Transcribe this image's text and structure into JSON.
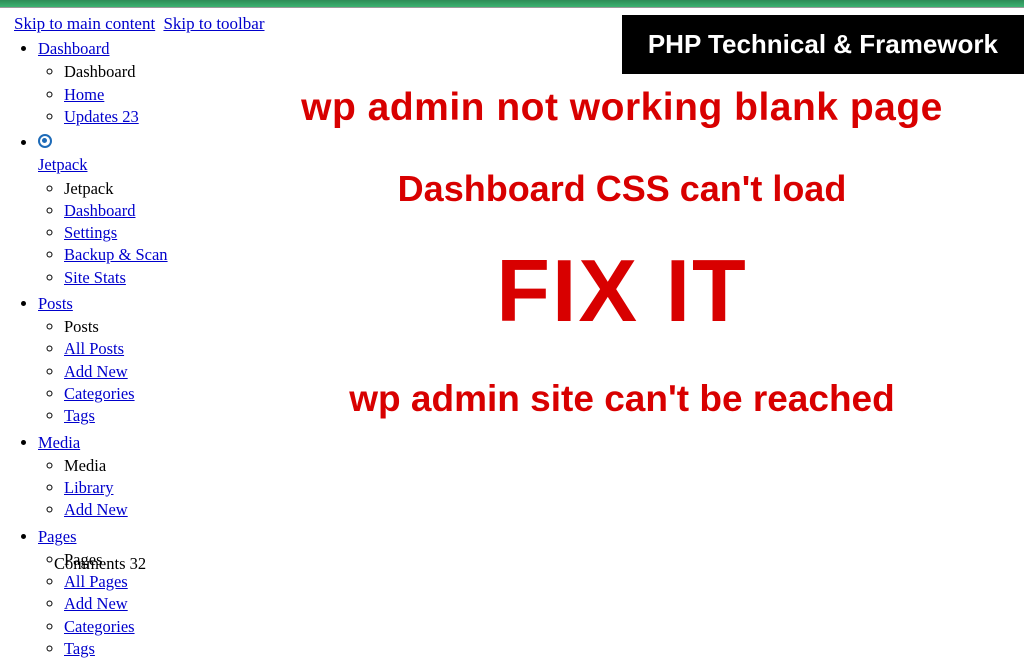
{
  "skip": {
    "main": "Skip to main content",
    "toolbar": "Skip to toolbar"
  },
  "badge": "PHP Technical & Framework",
  "headlines": {
    "a": "wp admin not working blank page",
    "b": "Dashboard CSS can't load",
    "c": "FIX IT",
    "d": "wp admin site can't be reached"
  },
  "menu": [
    {
      "label": "Dashboard",
      "icon": null,
      "items": [
        {
          "text": "Dashboard",
          "link": false
        },
        {
          "text": "Home",
          "link": true
        },
        {
          "text": "Updates 23",
          "link": true
        }
      ]
    },
    {
      "label": "Jetpack",
      "icon": "jetpack",
      "items": [
        {
          "text": "Jetpack",
          "link": false
        },
        {
          "text": "Dashboard",
          "link": true
        },
        {
          "text": "Settings",
          "link": true
        },
        {
          "text": "Backup & Scan",
          "link": true
        },
        {
          "text": "Site Stats",
          "link": true
        }
      ]
    },
    {
      "label": "Posts",
      "icon": null,
      "items": [
        {
          "text": "Posts",
          "link": false
        },
        {
          "text": "All Posts",
          "link": true
        },
        {
          "text": "Add New",
          "link": true
        },
        {
          "text": "Categories",
          "link": true
        },
        {
          "text": "Tags",
          "link": true
        }
      ]
    },
    {
      "label": "Media",
      "icon": null,
      "items": [
        {
          "text": "Media",
          "link": false
        },
        {
          "text": "Library",
          "link": true
        },
        {
          "text": "Add New",
          "link": true
        }
      ]
    },
    {
      "label": "Pages",
      "icon": null,
      "items": [
        {
          "text": "Pages",
          "link": false
        },
        {
          "text": "All Pages",
          "link": true
        },
        {
          "text": "Add New",
          "link": true
        },
        {
          "text": "Categories",
          "link": true
        },
        {
          "text": "Tags",
          "link": true
        }
      ]
    }
  ],
  "cutoff": "Comments 32"
}
